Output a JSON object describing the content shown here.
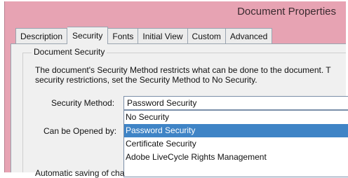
{
  "window": {
    "title": "Document Properties"
  },
  "tabs": [
    {
      "label": "Description"
    },
    {
      "label": "Security",
      "active": true
    },
    {
      "label": "Fonts"
    },
    {
      "label": "Initial View"
    },
    {
      "label": "Custom"
    },
    {
      "label": "Advanced"
    }
  ],
  "document_security": {
    "group_title": "Document Security",
    "description_line1": "The document's Security Method restricts what can be done to the document. T",
    "description_line2": "security restrictions, set the Security Method to No Security.",
    "security_method_label": "Security Method:",
    "security_method_value": "Password Security",
    "options": [
      {
        "label": "No Security"
      },
      {
        "label": "Password Security",
        "selected": true
      },
      {
        "label": "Certificate Security"
      },
      {
        "label": "Adobe LiveCycle Rights Management"
      }
    ],
    "can_be_opened_label": "Can be Opened by:",
    "autosave_text": "Automatic saving of cha"
  },
  "colors": {
    "window_frame": "#e7a3b3",
    "selection": "#3f84c6"
  }
}
